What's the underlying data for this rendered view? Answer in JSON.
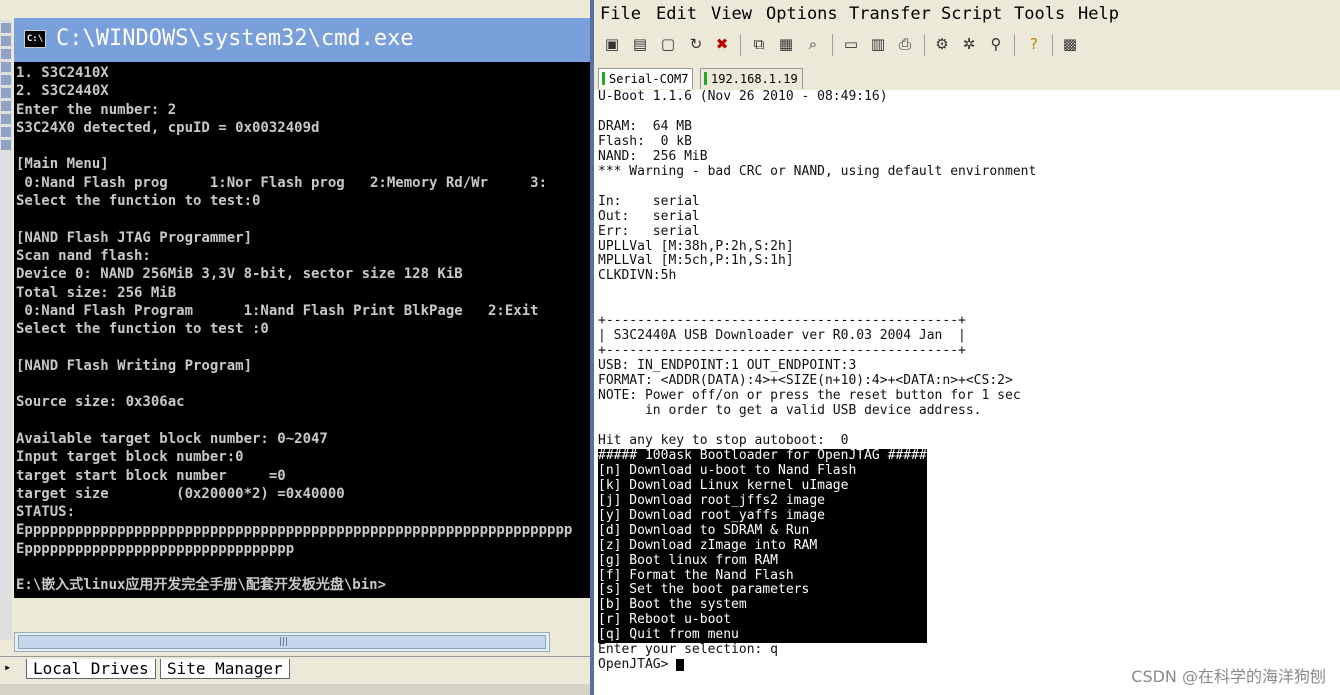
{
  "cmd": {
    "title": "C:\\WINDOWS\\system32\\cmd.exe",
    "icon_label": "C:\\",
    "lines": [
      "1. S3C2410X",
      "2. S3C2440X",
      "Enter the number: 2",
      "S3C24X0 detected, cpuID = 0x0032409d",
      "",
      "[Main Menu]",
      " 0:Nand Flash prog     1:Nor Flash prog   2:Memory Rd/Wr     3:",
      "Select the function to test:0",
      "",
      "[NAND Flash JTAG Programmer]",
      "Scan nand flash:",
      "Device 0: NAND 256MiB 3,3V 8-bit, sector size 128 KiB",
      "Total size: 256 MiB",
      " 0:Nand Flash Program      1:Nand Flash Print BlkPage   2:Exit",
      "Select the function to test :0",
      "",
      "[NAND Flash Writing Program]",
      "",
      "Source size: 0x306ac",
      "",
      "Available target block number: 0~2047",
      "Input target block number:0",
      "target start block number     =0",
      "target size        (0x20000*2) =0x40000",
      "STATUS:",
      "Eppppppppppppppppppppppppppppppppppppppppppppppppppppppppppppppppp",
      "Epppppppppppppppppppppppppppppppp",
      "",
      "E:\\嵌入式linux应用开发完全手册\\配套开发板光盘\\bin>"
    ]
  },
  "left_panel": {
    "scroll_grip": "|||",
    "tabs": [
      "Local Drives",
      "Site Manager"
    ]
  },
  "securecrt": {
    "menu": [
      "File",
      "Edit",
      "View",
      "Options",
      "Transfer",
      "Script",
      "Tools",
      "Help"
    ],
    "toolbar_icons": [
      "connect-icon",
      "quick-connect-icon",
      "connect-tab-icon",
      "reconnect-icon",
      "disconnect-icon",
      "copy-icon",
      "paste-icon",
      "find-icon",
      "print-setup-icon",
      "print-selection-icon",
      "print-icon",
      "session-options-icon",
      "global-options-icon",
      "keymap-icon",
      "help-icon",
      "sftp-icon"
    ],
    "tabs": [
      "Serial-COM7",
      "192.168.1.19"
    ],
    "terminal_lines": [
      "U-Boot 1.1.6 (Nov 26 2010 - 08:49:16)",
      "",
      "DRAM:  64 MB",
      "Flash:  0 kB",
      "NAND:  256 MiB",
      "*** Warning - bad CRC or NAND, using default environment",
      "",
      "In:    serial",
      "Out:   serial",
      "Err:   serial",
      "UPLLVal [M:38h,P:2h,S:2h]",
      "MPLLVal [M:5ch,P:1h,S:1h]",
      "CLKDIVN:5h",
      "",
      "",
      "+---------------------------------------------+",
      "| S3C2440A USB Downloader ver R0.03 2004 Jan  |",
      "+---------------------------------------------+",
      "USB: IN_ENDPOINT:1 OUT_ENDPOINT:3",
      "FORMAT: <ADDR(DATA):4>+<SIZE(n+10):4>+<DATA:n>+<CS:2>",
      "NOTE: Power off/on or press the reset button for 1 sec",
      "      in order to get a valid USB device address.",
      "",
      "Hit any key to stop autoboot:  0",
      ""
    ],
    "menu_lines": [
      "##### 100ask Bootloader for OpenJTAG #####",
      "[n] Download u-boot to Nand Flash",
      "[k] Download Linux kernel uImage",
      "[j] Download root_jffs2 image",
      "[y] Download root_yaffs image",
      "[d] Download to SDRAM & Run",
      "[z] Download zImage into RAM",
      "[g] Boot linux from RAM",
      "[f] Format the Nand Flash",
      "[s] Set the boot parameters",
      "[b] Boot the system",
      "[r] Reboot u-boot",
      "[q] Quit from menu"
    ],
    "tail_lines": [
      "Enter your selection: q",
      "OpenJTAG> "
    ]
  },
  "watermark": "CSDN @在科学的海洋狗刨"
}
